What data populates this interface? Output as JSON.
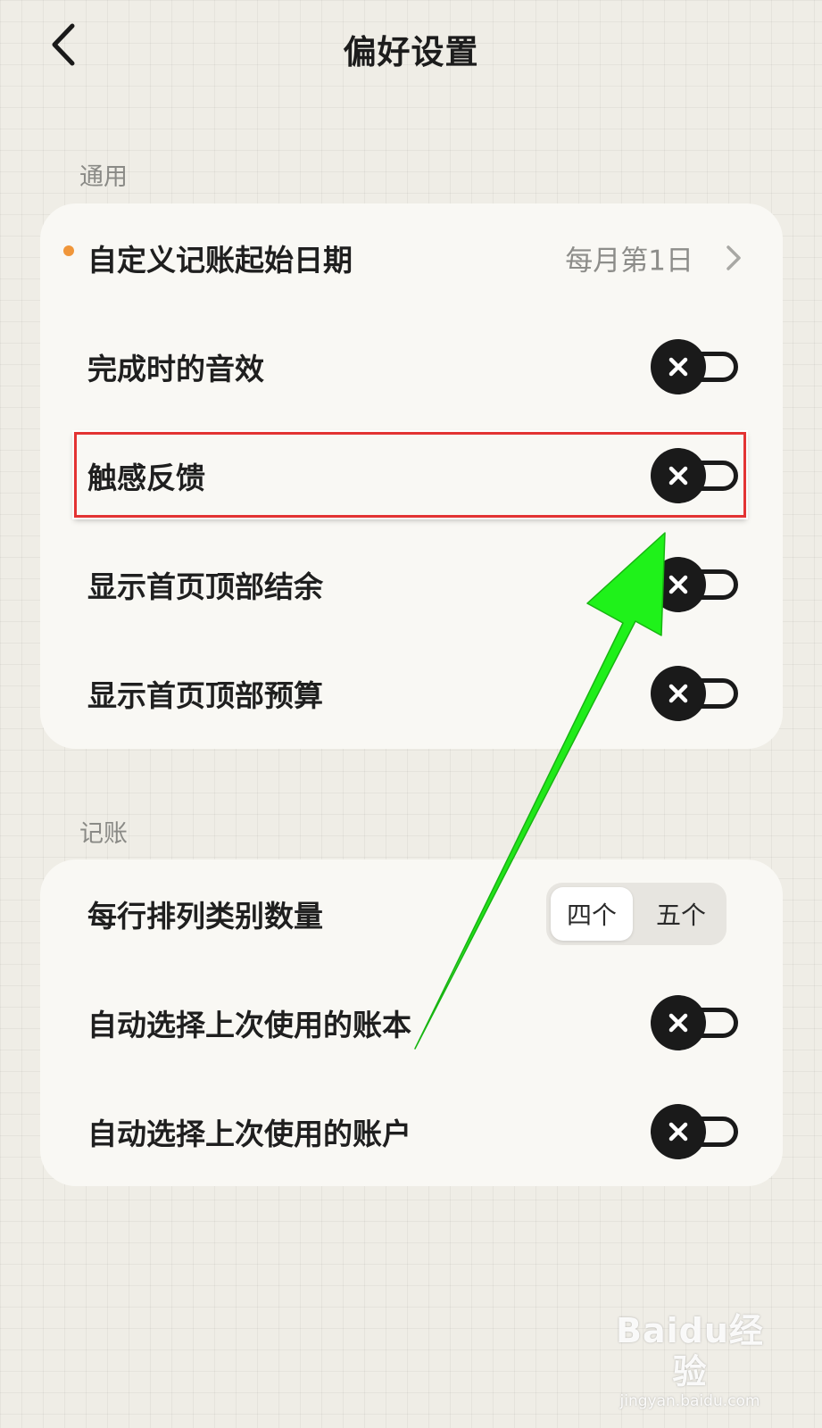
{
  "header": {
    "title": "偏好设置",
    "back_icon": "chevron-left-icon"
  },
  "sections": [
    {
      "label": "通用",
      "rows": [
        {
          "label": "自定义记账起始日期",
          "value": "每月第1日",
          "control": "nav",
          "has_dot": true,
          "dot_color": "#f0963a"
        },
        {
          "label": "完成时的音效",
          "control": "toggle",
          "state": "off"
        },
        {
          "label": "触感反馈",
          "control": "toggle",
          "state": "off",
          "highlighted": true
        },
        {
          "label": "显示首页顶部结余",
          "control": "toggle",
          "state": "off"
        },
        {
          "label": "显示首页顶部预算",
          "control": "toggle",
          "state": "off"
        }
      ]
    },
    {
      "label": "记账",
      "rows": [
        {
          "label": "每行排列类别数量",
          "control": "segmented",
          "options": [
            "四个",
            "五个"
          ],
          "selected": "四个"
        },
        {
          "label": "自动选择上次使用的账本",
          "control": "toggle",
          "state": "off"
        },
        {
          "label": "自动选择上次使用的账户",
          "control": "toggle",
          "state": "off"
        }
      ]
    }
  ],
  "annotations": {
    "highlight_color": "#e33333",
    "arrow_color": "#22e01a"
  },
  "watermark": {
    "logo": "Baidu经验",
    "url": "jingyan.baidu.com"
  },
  "colors": {
    "background": "#efede6",
    "card": "#f9f8f4",
    "toggle_off": "#1a1a1a",
    "accent_dot": "#f0963a"
  }
}
